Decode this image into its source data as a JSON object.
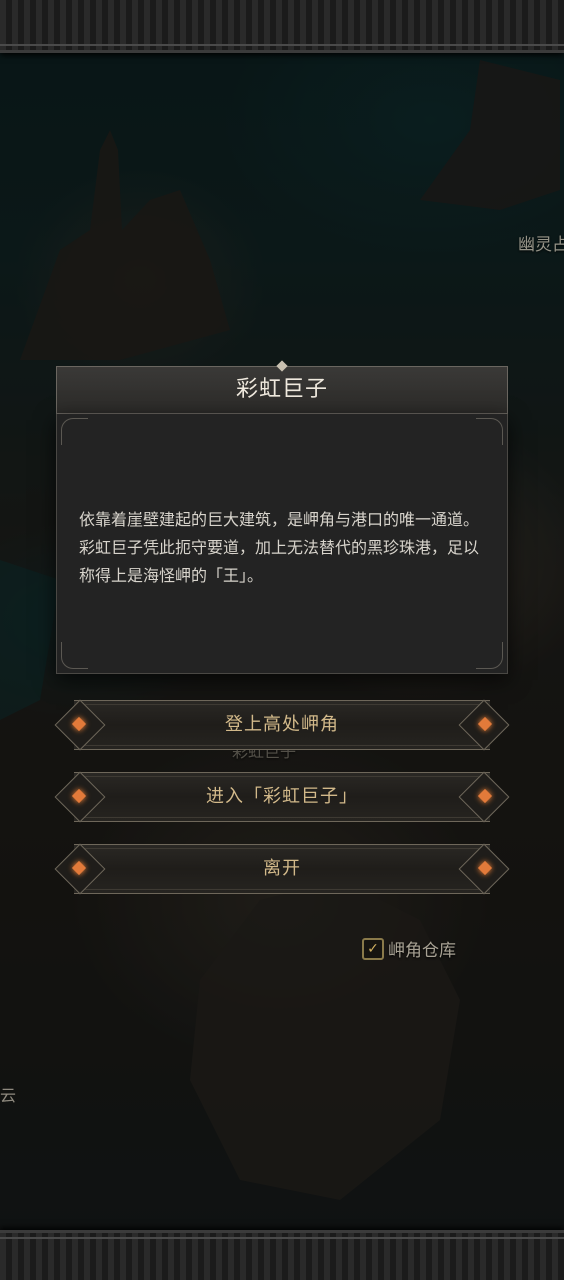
{
  "map": {
    "label_ghost": "幽灵占",
    "label_faded": "彩虹巨子",
    "label_warehouse": "岬角仓库",
    "edge_text": "云"
  },
  "dialog": {
    "title": "彩虹巨子",
    "text": "依靠着崖壁建起的巨大建筑，是岬角与港口的唯一通道。彩虹巨子凭此扼守要道，加上无法替代的黑珍珠港，足以称得上是海怪岬的「王」。"
  },
  "options": [
    {
      "label": "登上高处岬角"
    },
    {
      "label": "进入「彩虹巨子」"
    },
    {
      "label": "离开"
    }
  ],
  "colors": {
    "accent_gem": "#e27a3a",
    "option_text": "#d2b98a",
    "dialog_bg": "#232323"
  }
}
